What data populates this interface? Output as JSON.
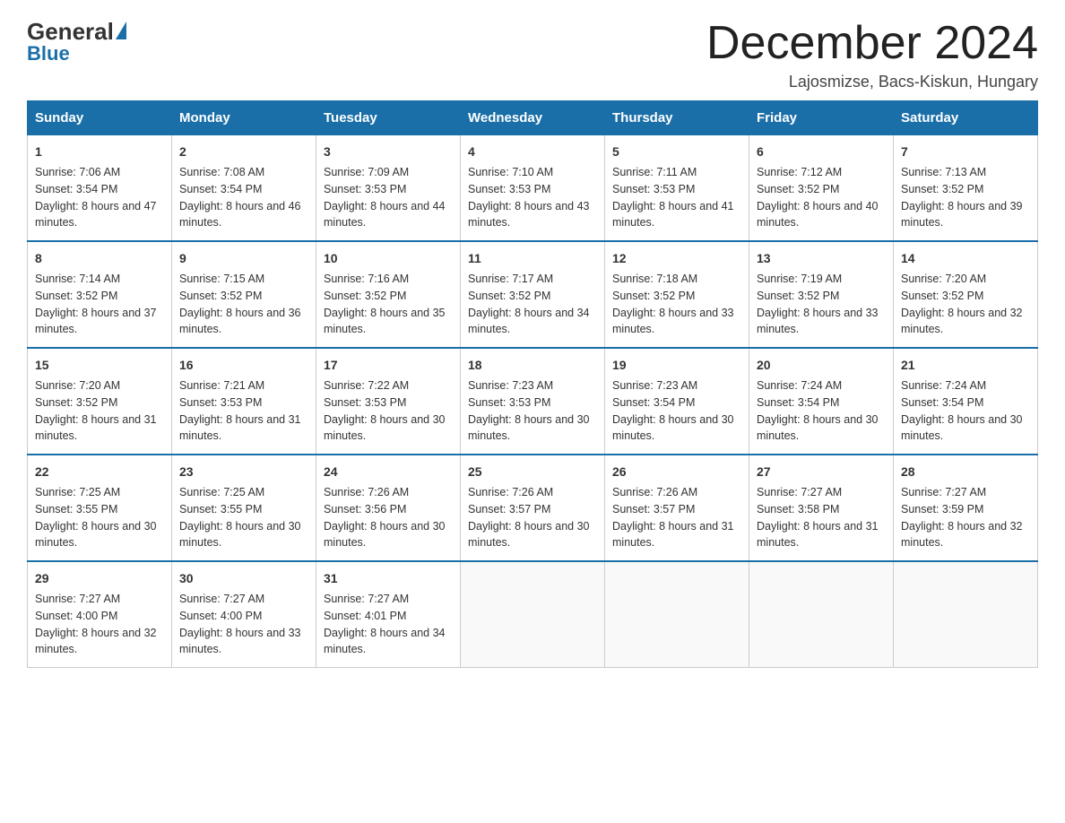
{
  "logo": {
    "general": "General",
    "triangle": "",
    "blue_label": "Blue"
  },
  "header": {
    "month_title": "December 2024",
    "location": "Lajosmizse, Bacs-Kiskun, Hungary"
  },
  "weekdays": [
    "Sunday",
    "Monday",
    "Tuesday",
    "Wednesday",
    "Thursday",
    "Friday",
    "Saturday"
  ],
  "weeks": [
    [
      {
        "day": "1",
        "sunrise": "7:06 AM",
        "sunset": "3:54 PM",
        "daylight": "8 hours and 47 minutes."
      },
      {
        "day": "2",
        "sunrise": "7:08 AM",
        "sunset": "3:54 PM",
        "daylight": "8 hours and 46 minutes."
      },
      {
        "day": "3",
        "sunrise": "7:09 AM",
        "sunset": "3:53 PM",
        "daylight": "8 hours and 44 minutes."
      },
      {
        "day": "4",
        "sunrise": "7:10 AM",
        "sunset": "3:53 PM",
        "daylight": "8 hours and 43 minutes."
      },
      {
        "day": "5",
        "sunrise": "7:11 AM",
        "sunset": "3:53 PM",
        "daylight": "8 hours and 41 minutes."
      },
      {
        "day": "6",
        "sunrise": "7:12 AM",
        "sunset": "3:52 PM",
        "daylight": "8 hours and 40 minutes."
      },
      {
        "day": "7",
        "sunrise": "7:13 AM",
        "sunset": "3:52 PM",
        "daylight": "8 hours and 39 minutes."
      }
    ],
    [
      {
        "day": "8",
        "sunrise": "7:14 AM",
        "sunset": "3:52 PM",
        "daylight": "8 hours and 37 minutes."
      },
      {
        "day": "9",
        "sunrise": "7:15 AM",
        "sunset": "3:52 PM",
        "daylight": "8 hours and 36 minutes."
      },
      {
        "day": "10",
        "sunrise": "7:16 AM",
        "sunset": "3:52 PM",
        "daylight": "8 hours and 35 minutes."
      },
      {
        "day": "11",
        "sunrise": "7:17 AM",
        "sunset": "3:52 PM",
        "daylight": "8 hours and 34 minutes."
      },
      {
        "day": "12",
        "sunrise": "7:18 AM",
        "sunset": "3:52 PM",
        "daylight": "8 hours and 33 minutes."
      },
      {
        "day": "13",
        "sunrise": "7:19 AM",
        "sunset": "3:52 PM",
        "daylight": "8 hours and 33 minutes."
      },
      {
        "day": "14",
        "sunrise": "7:20 AM",
        "sunset": "3:52 PM",
        "daylight": "8 hours and 32 minutes."
      }
    ],
    [
      {
        "day": "15",
        "sunrise": "7:20 AM",
        "sunset": "3:52 PM",
        "daylight": "8 hours and 31 minutes."
      },
      {
        "day": "16",
        "sunrise": "7:21 AM",
        "sunset": "3:53 PM",
        "daylight": "8 hours and 31 minutes."
      },
      {
        "day": "17",
        "sunrise": "7:22 AM",
        "sunset": "3:53 PM",
        "daylight": "8 hours and 30 minutes."
      },
      {
        "day": "18",
        "sunrise": "7:23 AM",
        "sunset": "3:53 PM",
        "daylight": "8 hours and 30 minutes."
      },
      {
        "day": "19",
        "sunrise": "7:23 AM",
        "sunset": "3:54 PM",
        "daylight": "8 hours and 30 minutes."
      },
      {
        "day": "20",
        "sunrise": "7:24 AM",
        "sunset": "3:54 PM",
        "daylight": "8 hours and 30 minutes."
      },
      {
        "day": "21",
        "sunrise": "7:24 AM",
        "sunset": "3:54 PM",
        "daylight": "8 hours and 30 minutes."
      }
    ],
    [
      {
        "day": "22",
        "sunrise": "7:25 AM",
        "sunset": "3:55 PM",
        "daylight": "8 hours and 30 minutes."
      },
      {
        "day": "23",
        "sunrise": "7:25 AM",
        "sunset": "3:55 PM",
        "daylight": "8 hours and 30 minutes."
      },
      {
        "day": "24",
        "sunrise": "7:26 AM",
        "sunset": "3:56 PM",
        "daylight": "8 hours and 30 minutes."
      },
      {
        "day": "25",
        "sunrise": "7:26 AM",
        "sunset": "3:57 PM",
        "daylight": "8 hours and 30 minutes."
      },
      {
        "day": "26",
        "sunrise": "7:26 AM",
        "sunset": "3:57 PM",
        "daylight": "8 hours and 31 minutes."
      },
      {
        "day": "27",
        "sunrise": "7:27 AM",
        "sunset": "3:58 PM",
        "daylight": "8 hours and 31 minutes."
      },
      {
        "day": "28",
        "sunrise": "7:27 AM",
        "sunset": "3:59 PM",
        "daylight": "8 hours and 32 minutes."
      }
    ],
    [
      {
        "day": "29",
        "sunrise": "7:27 AM",
        "sunset": "4:00 PM",
        "daylight": "8 hours and 32 minutes."
      },
      {
        "day": "30",
        "sunrise": "7:27 AM",
        "sunset": "4:00 PM",
        "daylight": "8 hours and 33 minutes."
      },
      {
        "day": "31",
        "sunrise": "7:27 AM",
        "sunset": "4:01 PM",
        "daylight": "8 hours and 34 minutes."
      },
      null,
      null,
      null,
      null
    ]
  ],
  "labels": {
    "sunrise_prefix": "Sunrise: ",
    "sunset_prefix": "Sunset: ",
    "daylight_prefix": "Daylight: "
  }
}
